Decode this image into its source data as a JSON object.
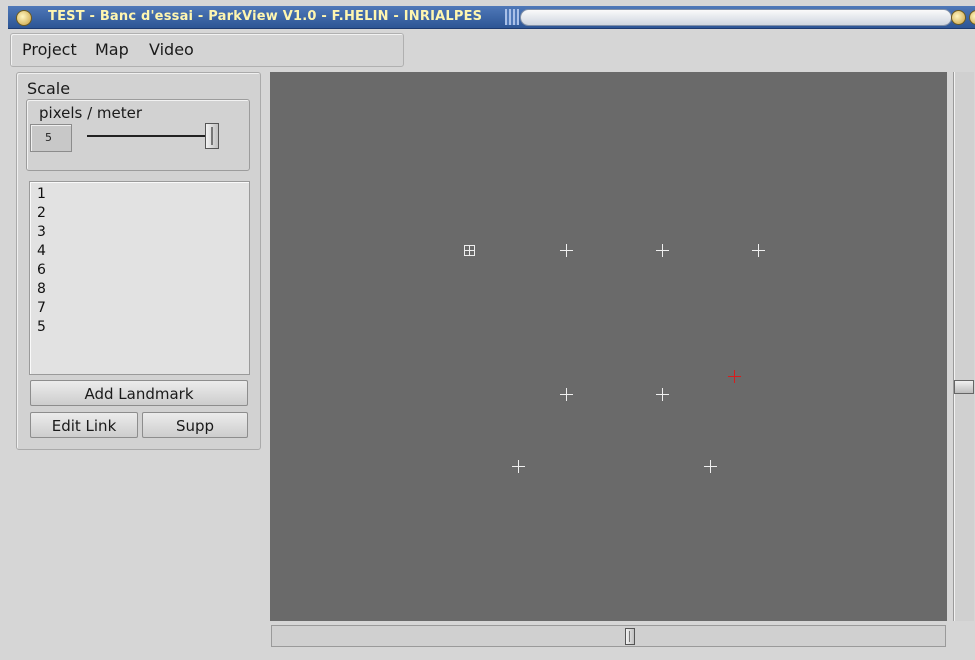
{
  "window": {
    "title": "TEST - Banc d'essai - ParkView V1.0 - F.HELIN - INRIALPES"
  },
  "menubar": {
    "items": [
      "Project",
      "Map",
      "Video"
    ]
  },
  "scale_panel": {
    "title": "Scale",
    "group_label": "pixels / meter",
    "value": "5",
    "slider_level_fraction": 1.0
  },
  "landmark_list": {
    "items": [
      "1",
      "2",
      "3",
      "4",
      "6",
      "8",
      "7",
      "5"
    ]
  },
  "buttons": {
    "add_landmark": "Add Landmark",
    "edit_link": "Edit Link",
    "supp": "Supp"
  },
  "colors": {
    "canvas": "#6a6a6a",
    "landmark_marker": "#f0f0f0",
    "selected_marker": "#d81c1c",
    "titlebar": "#2c5595"
  },
  "map": {
    "markers": [
      "square-landmark-icon",
      "cross-icon",
      "cross-icon",
      "cross-icon",
      "cross-icon",
      "cross-icon",
      "cross-icon",
      "cross-icon",
      "red-cross-icon"
    ]
  }
}
